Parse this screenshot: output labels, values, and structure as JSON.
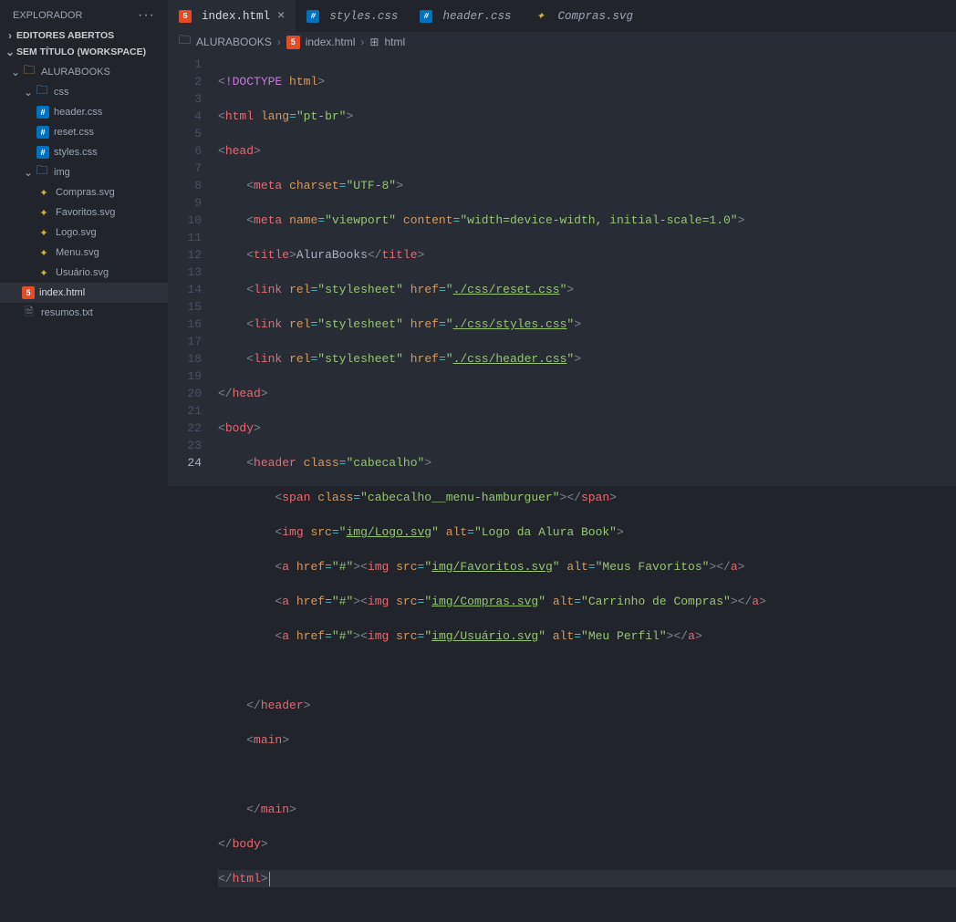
{
  "sidebar": {
    "title": "EXPLORADOR",
    "sections": {
      "open_editors": "EDITORES ABERTOS",
      "workspace": "SEM TÍTULO (WORKSPACE)"
    },
    "root": "ALURABOOKS",
    "css_folder": "css",
    "img_folder": "img",
    "files": {
      "header_css": "header.css",
      "reset_css": "reset.css",
      "styles_css": "styles.css",
      "compras_svg": "Compras.svg",
      "favoritos_svg": "Favoritos.svg",
      "logo_svg": "Logo.svg",
      "menu_svg": "Menu.svg",
      "usuario_svg": "Usuário.svg",
      "index_html": "index.html",
      "resumos_txt": "resumos.txt"
    }
  },
  "tabs": [
    {
      "label": "index.html",
      "type": "html",
      "active": true
    },
    {
      "label": "styles.css",
      "type": "css",
      "active": false
    },
    {
      "label": "header.css",
      "type": "css",
      "active": false
    },
    {
      "label": "Compras.svg",
      "type": "svg",
      "active": false
    }
  ],
  "breadcrumb": {
    "p0": "ALURABOOKS",
    "p1": "index.html",
    "p2": "html"
  },
  "code": {
    "l1": {
      "raw": "<!DOCTYPE html>"
    },
    "l2": {
      "tag": "html",
      "attr": "lang",
      "val": "\"pt-br\""
    },
    "l3": {
      "tag": "head"
    },
    "l4": {
      "tag": "meta",
      "attr": "charset",
      "val": "\"UTF-8\""
    },
    "l5": {
      "tag": "meta",
      "a1": "name",
      "v1": "\"viewport\"",
      "a2": "content",
      "v2": "\"width=device-width, initial-scale=1.0\""
    },
    "l6": {
      "tag": "title",
      "text": "AluraBooks"
    },
    "l7": {
      "tag": "link",
      "a1": "rel",
      "v1": "\"stylesheet\"",
      "a2": "href",
      "v2pre": "\"",
      "v2link": "./css/reset.css",
      "v2post": "\""
    },
    "l8": {
      "tag": "link",
      "a1": "rel",
      "v1": "\"stylesheet\"",
      "a2": "href",
      "v2pre": "\"",
      "v2link": "./css/styles.css",
      "v2post": "\""
    },
    "l9": {
      "tag": "link",
      "a1": "rel",
      "v1": "\"stylesheet\"",
      "a2": "href",
      "v2pre": "\"",
      "v2link": "./css/header.css",
      "v2post": "\""
    },
    "l10": {
      "tagc": "head"
    },
    "l11": {
      "tag": "body"
    },
    "l12": {
      "tag": "header",
      "attr": "class",
      "val": "\"cabecalho\""
    },
    "l13": {
      "tag": "span",
      "attr": "class",
      "val": "\"cabecalho__menu-hamburguer\"",
      "tagc": "span"
    },
    "l14": {
      "tag": "img",
      "a1": "src",
      "v1pre": "\"",
      "v1link": "img/Logo.svg",
      "v1post": "\"",
      "a2": "alt",
      "v2": "\"Logo da Alura Book\""
    },
    "l15": {
      "otag": "a",
      "ohref": "\"#\"",
      "itag": "img",
      "a1": "src",
      "v1pre": "\"",
      "v1link": "img/Favoritos.svg",
      "v1post": "\"",
      "a2": "alt",
      "v2": "\"Meus Favoritos\"",
      "ctag": "a"
    },
    "l16": {
      "otag": "a",
      "ohref": "\"#\"",
      "itag": "img",
      "a1": "src",
      "v1pre": "\"",
      "v1link": "img/Compras.svg",
      "v1post": "\"",
      "a2": "alt",
      "v2": "\"Carrinho de Compras\"",
      "ctag": "a"
    },
    "l17": {
      "otag": "a",
      "ohref": "\"#\"",
      "itag": "img",
      "a1": "src",
      "v1pre": "\"",
      "v1link": "img/Usuário.svg",
      "v1post": "\"",
      "a2": "alt",
      "v2": "\"Meu Perfil\"",
      "ctag": "a"
    },
    "l19": {
      "tagc": "header"
    },
    "l20": {
      "tag": "main"
    },
    "l22": {
      "tagc": "main"
    },
    "l23": {
      "tagc": "body"
    },
    "l24": {
      "tagc": "html"
    }
  }
}
